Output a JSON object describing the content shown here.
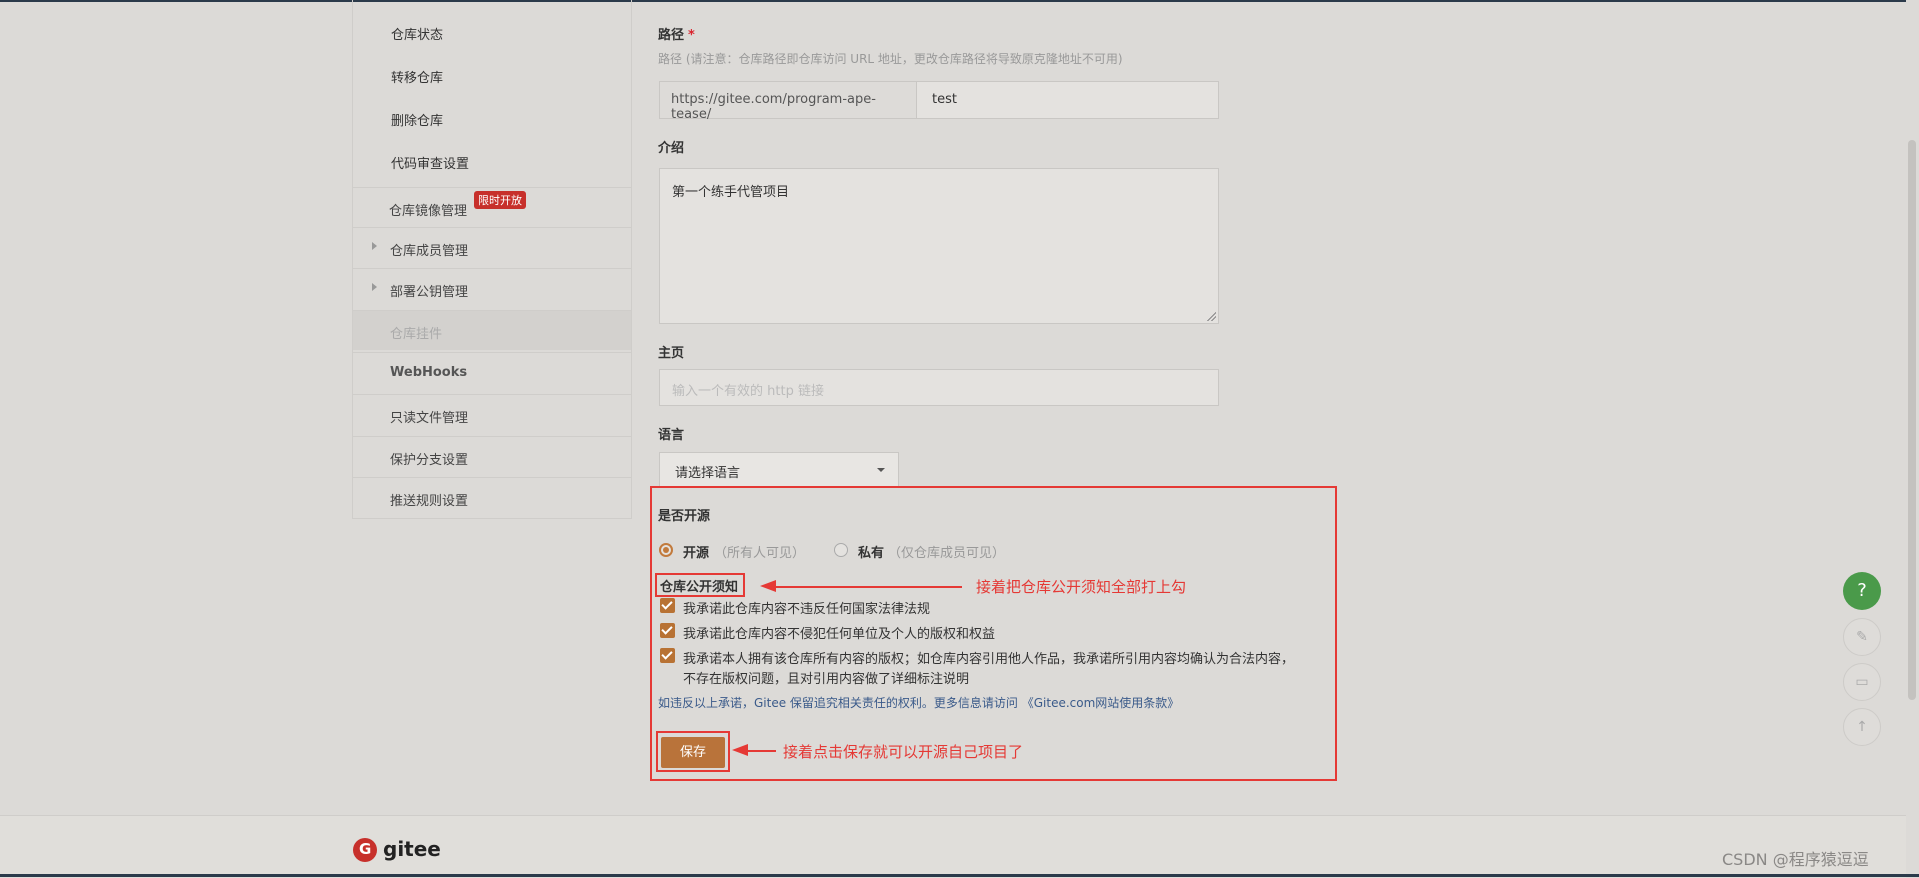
{
  "sidebar": {
    "sub_items": [
      "仓库状态",
      "转移仓库",
      "删除仓库",
      "代码审查设置"
    ],
    "sections": [
      {
        "label": "仓库镜像管理",
        "badge": "限时开放"
      },
      {
        "label": "仓库成员管理"
      },
      {
        "label": "部署公钥管理"
      },
      {
        "label": "仓库挂件"
      },
      {
        "label": "WebHooks"
      },
      {
        "label": "只读文件管理"
      },
      {
        "label": "保护分支设置"
      },
      {
        "label": "推送规则设置"
      }
    ]
  },
  "form": {
    "path_label": "路径",
    "required_mark": "*",
    "path_hint": "路径 (请注意：仓库路径即仓库访问 URL 地址，更改仓库路径将导致原克隆地址不可用)",
    "path_prefix": "https://gitee.com/program-ape-tease/",
    "path_value": "test",
    "intro_label": "介绍",
    "intro_value": "第一个练手代管项目",
    "homepage_label": "主页",
    "homepage_placeholder": "输入一个有效的 http 链接",
    "language_label": "语言",
    "language_value": "请选择语言",
    "open_source_label": "是否开源",
    "open_option": "开源",
    "open_option_desc": "（所有人可见）",
    "private_option": "私有",
    "private_option_desc": "（仅仓库成员可见）",
    "notice_label": "仓库公开须知",
    "pledges": [
      "我承诺此仓库内容不违反任何国家法律法规",
      "我承诺此仓库内容不侵犯任何单位及个人的版权和权益",
      "我承诺本人拥有该仓库所有内容的版权；如仓库内容引用他人作品，我承诺所引用内容均确认为合法内容，",
      "不存在版权问题，且对引用内容做了详细标注说明"
    ],
    "warning": "如违反以上承诺，Gitee 保留追究相关责任的权利。更多信息请访问 《Gitee.com网站使用条款》",
    "save_label": "保存"
  },
  "annotations": {
    "check_all": "接着把仓库公开须知全部打上勾",
    "click_save": "接着点击保存就可以开源自己项目了"
  },
  "floating": {
    "help": "?"
  },
  "footer": {
    "logo_text": "gitee"
  },
  "watermark": "CSDN @程序猿逗逗",
  "colors": {
    "accent": "#b9733a",
    "annotation": "#e53935",
    "badge": "#c7302b",
    "help": "#4a9a4a"
  }
}
